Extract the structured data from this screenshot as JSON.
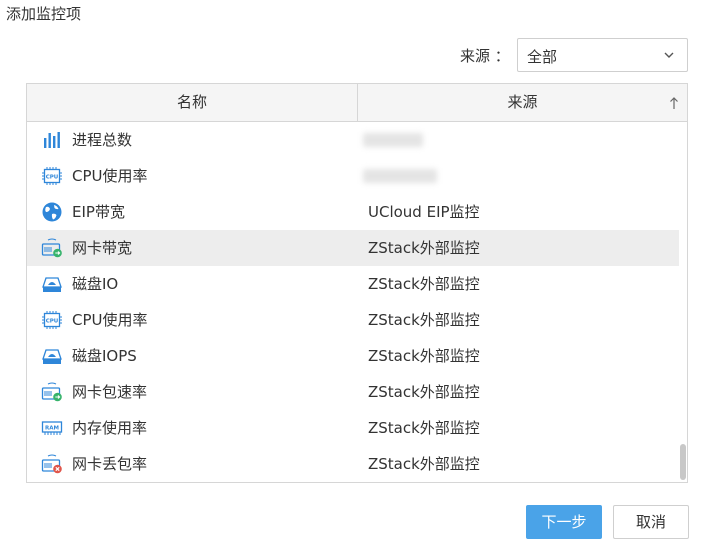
{
  "dialog": {
    "title": "添加监控项"
  },
  "filter": {
    "label": "来源 ：",
    "selected": "全部"
  },
  "table": {
    "columns": [
      {
        "label": "名称"
      },
      {
        "label": "来源",
        "sort": "ascending"
      }
    ],
    "rows": [
      {
        "name": "进程总数",
        "source": "",
        "icon": "bar-chart-icon",
        "source_obscured": true
      },
      {
        "name": "CPU使用率",
        "source": "",
        "icon": "cpu-icon",
        "source_obscured": true
      },
      {
        "name": "EIP带宽",
        "source": "UCloud EIP监控",
        "icon": "globe-icon"
      },
      {
        "name": "网卡带宽",
        "source": "ZStack外部监控",
        "icon": "nic-bandwidth-icon",
        "selected": true
      },
      {
        "name": "磁盘IO",
        "source": "ZStack外部监控",
        "icon": "disk-icon"
      },
      {
        "name": "CPU使用率",
        "source": "ZStack外部监控",
        "icon": "cpu-icon"
      },
      {
        "name": "磁盘IOPS",
        "source": "ZStack外部监控",
        "icon": "disk-icon"
      },
      {
        "name": "网卡包速率",
        "source": "ZStack外部监控",
        "icon": "nic-packet-rate-icon"
      },
      {
        "name": "内存使用率",
        "source": "ZStack外部监控",
        "icon": "ram-icon"
      },
      {
        "name": "网卡丢包率",
        "source": "ZStack外部监控",
        "icon": "nic-packet-loss-icon"
      }
    ]
  },
  "buttons": {
    "next": "下一步",
    "cancel": "取消"
  },
  "colors": {
    "primary": "#4aa3e8",
    "icon_blue": "#2e86d9",
    "selected_row": "#ededed",
    "green": "#36b36b",
    "red": "#e0554a"
  }
}
